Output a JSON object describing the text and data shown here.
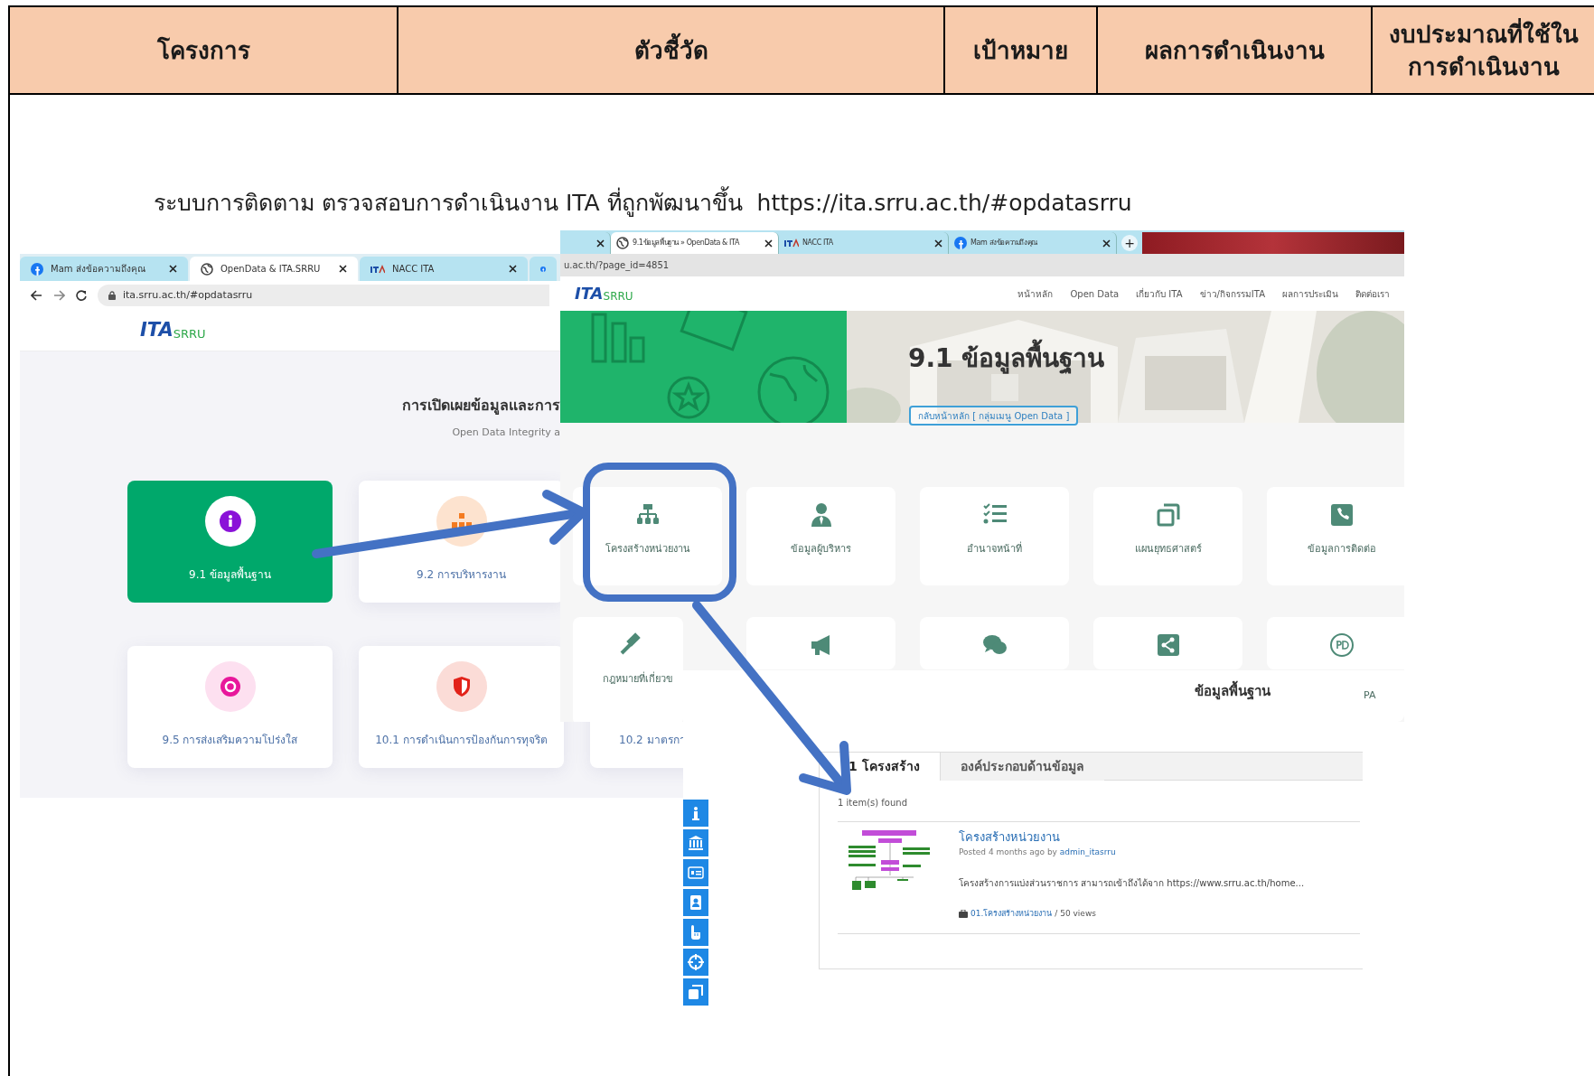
{
  "table_header": {
    "columns": [
      {
        "lines": [
          "โครงการ"
        ]
      },
      {
        "lines": [
          "ตัวชี้วัด"
        ]
      },
      {
        "lines": [
          "เป้าหมาย"
        ]
      },
      {
        "lines": [
          "ผลการดำเนินงาน"
        ]
      },
      {
        "lines": [
          "งบประมาณที่ใช้ใน",
          "การดำเนินงาน"
        ]
      }
    ]
  },
  "caption": "ระบบการติดตาม ตรวจสอบการดำเนินงาน ITA ที่ถูกพัฒนาขึ้น  https://ita.srru.ac.th/#opdatasrru",
  "screenshot_home": {
    "tabs": [
      {
        "title": "Mam ส่งข้อความถึงคุณ",
        "kind": "social",
        "selected": false
      },
      {
        "title": "OpenData & ITA.SRRU",
        "kind": "globe",
        "selected": true
      },
      {
        "title": "NACC ITA",
        "kind": "site",
        "selected": false
      },
      {
        "kind": "social",
        "selected": false
      }
    ],
    "address": "ita.srru.ac.th/#opdatasrru",
    "logo": {
      "mark": "ITA",
      "sub": "SRRU"
    },
    "heading": "การเปิดเผยข้อมูลและการ",
    "subheading": "Open Data Integrity a",
    "cards": [
      {
        "label": "9.1 ข้อมูลพื้นฐาน",
        "selected": true
      },
      {
        "label": "9.2 การบริหารงาน",
        "selected": false
      },
      {
        "label": "9.5 การส่งเสริมความโปร่งใส",
        "selected": false
      },
      {
        "label": "10.1 การดำเนินการป้องกันการทุจริต",
        "selected": false
      },
      {
        "label": "10.2 มาตรกา",
        "selected": false
      }
    ]
  },
  "screenshot_page": {
    "tabs": [
      {
        "kind": "blank",
        "selected": false
      },
      {
        "title": "9.1ข้อมูลพื้นฐาน » OpenData & ITA",
        "kind": "globe",
        "selected": true
      },
      {
        "title": "NACC ITA",
        "kind": "site",
        "selected": false
      },
      {
        "title": "Mam ส่งข้อความถึงคุณ",
        "kind": "social",
        "selected": false
      }
    ],
    "new_tab": "+",
    "address": "u.ac.th/?page_id=4851",
    "logo": {
      "mark": "ITA",
      "sub": "SRRU"
    },
    "nav": [
      "หน้าหลัก",
      "Open Data",
      "เกี่ยวกับ ITA",
      "ข่าว/กิจกรรมITA",
      "ผลการประเมิน",
      "ติดต่อเรา"
    ],
    "title": "9.1 ข้อมูลพื้นฐาน",
    "back_button": "กลับหน้าหลัก [ กลุ่มเมนู Open Data ]",
    "menu_labels": [
      "โครงสร้างหน่วยงาน",
      "ข้อมูลผู้บริหาร",
      "อำนาจหน้าที่",
      "แผนยุทธศาสตร์",
      "ข้อมูลการติดต่อ",
      "กฎหมายที่เกี่ยวข",
      "PA"
    ]
  },
  "screenshot_list": {
    "title": "ข้อมูลพื้นฐาน",
    "tabs": [
      {
        "label": "1 โครงสร้าง",
        "selected": true
      },
      {
        "label": "องค์ประกอบด้านข้อมูล",
        "selected": false
      }
    ],
    "count": "1 item(s) found",
    "items": [
      {
        "title": "โครงสร้างหน่วยงาน",
        "posted": "Posted 4 months ago by",
        "author": "admin_itasrru",
        "excerpt": "โครงสร้างการแบ่งส่วนราชการ สามารถเข้าถึงได้จาก https://www.srru.ac.th/home...",
        "category": "01.โครงสร้างหน่วยงาน",
        "views": "/ 50 views"
      }
    ]
  }
}
